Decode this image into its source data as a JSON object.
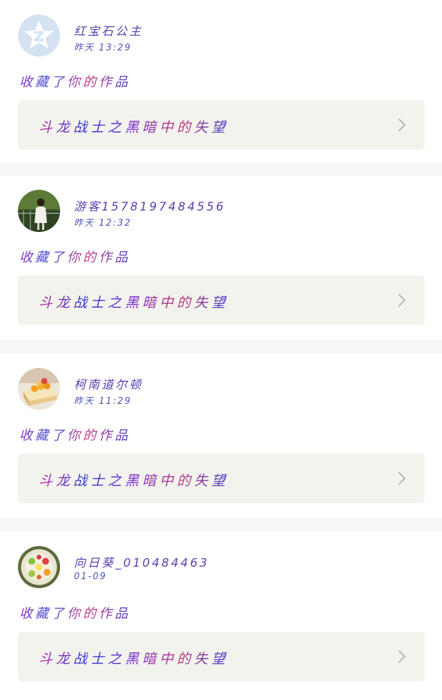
{
  "feed": {
    "items": [
      {
        "username": "红宝石公主",
        "time": "昨天 13:29",
        "action": "收藏了你的作品",
        "work_title": "斗龙战士之黑暗中的失望",
        "avatar_icon": "default-star-avatar-icon"
      },
      {
        "username": "游客1578197484556",
        "time": "昨天 12:32",
        "action": "收藏了你的作品",
        "work_title": "斗龙战士之黑暗中的失望",
        "avatar_icon": "photo-avatar-girl-icon"
      },
      {
        "username": "柯南道尔顿",
        "time": "昨天 11:29",
        "action": "收藏了你的作品",
        "work_title": "斗龙战士之黑暗中的失望",
        "avatar_icon": "photo-avatar-cake-icon"
      },
      {
        "username": "向日葵_010484463",
        "time": "01-09",
        "action": "收藏了你的作品",
        "work_title": "斗龙战士之黑暗中的失望",
        "avatar_icon": "photo-avatar-fruit-plate-icon"
      }
    ]
  },
  "colors": {
    "background": "#f6f5f7",
    "card": "#ffffff",
    "work_box": "#f3f3ee",
    "chevron": "#b8b8b8"
  }
}
